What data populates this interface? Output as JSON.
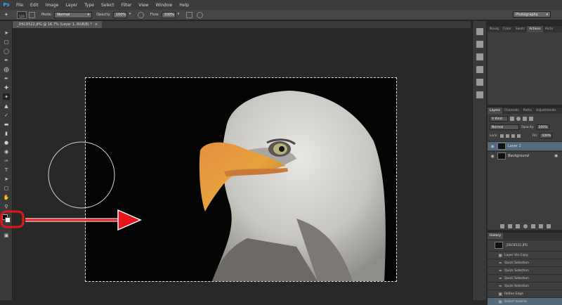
{
  "menu": [
    "File",
    "Edit",
    "Image",
    "Layer",
    "Type",
    "Select",
    "Filter",
    "View",
    "Window",
    "Help"
  ],
  "app_logo": "Ps",
  "options": {
    "brush_size": "123",
    "mode_label": "Mode:",
    "mode_value": "Normal",
    "opacity_label": "Opacity:",
    "opacity_value": "100%",
    "flow_label": "Flow:",
    "flow_value": "100%",
    "workspace": "Photography"
  },
  "document_tab": "_DSC8522.JPG @ 16.7% (Layer 1, RGB/8) *",
  "top_panel_tabs": [
    "Navig",
    "Color",
    "Swatc",
    "Actions",
    "Histo"
  ],
  "layers_panel": {
    "tabs": [
      "Layers",
      "Channels",
      "Paths",
      "Adjustments"
    ],
    "kind_label": "Kind",
    "blend_mode": "Normal",
    "opacity_label": "Opacity:",
    "opacity_value": "100%",
    "lock_label": "Lock:",
    "fill_label": "Fill:",
    "fill_value": "100%",
    "layers": [
      {
        "name": "Layer 1"
      },
      {
        "name": "Background"
      }
    ]
  },
  "history_panel": {
    "title": "History",
    "snapshot": "_DSC8522.JPG",
    "steps": [
      "Layer Via Copy",
      "Quick Selection",
      "Quick Selection",
      "Quick Selection",
      "Quick Selection",
      "Refine Edge",
      "Select Inverse"
    ]
  },
  "colors": {
    "menubar": "#3c3c3c",
    "canvas_bg": "#282828",
    "annotation_red": "#e8141b",
    "beak": "#e2a23a",
    "feather": "#d9d7d2"
  }
}
